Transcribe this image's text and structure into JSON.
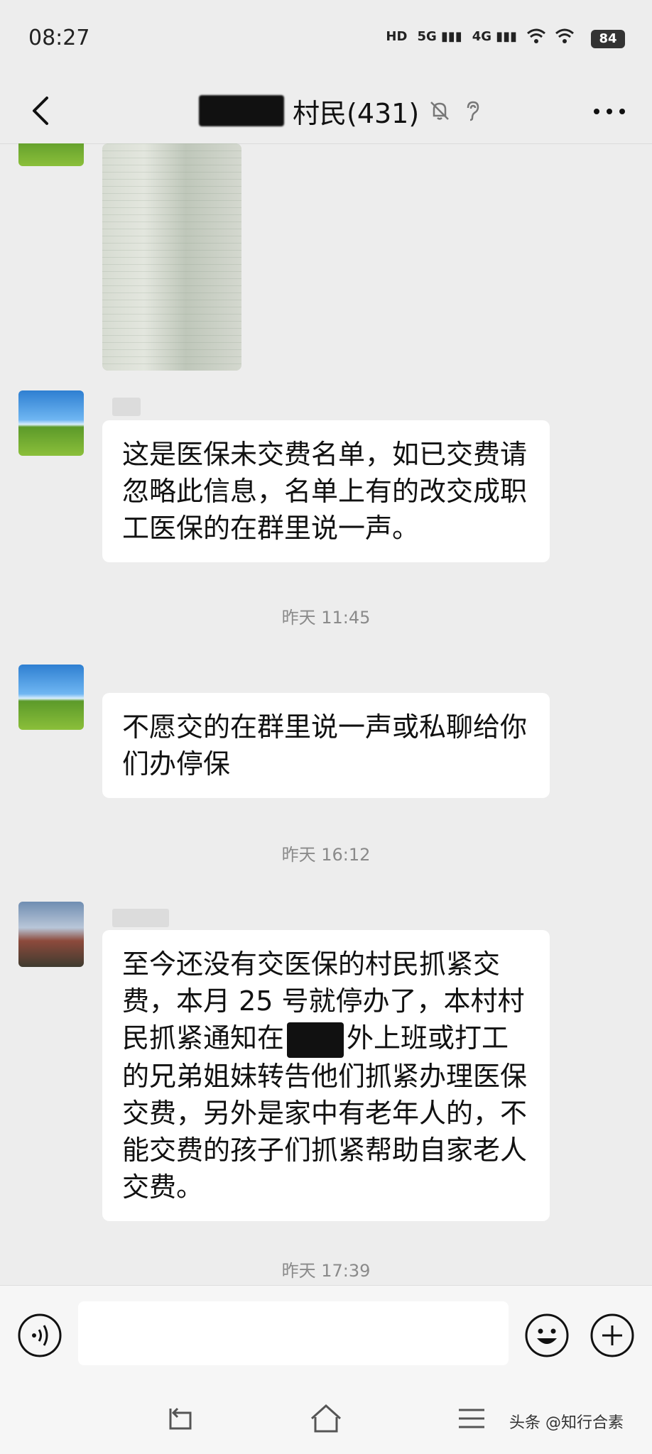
{
  "status_bar": {
    "time": "08:27",
    "indicators": [
      "HD",
      "5G",
      "4G",
      "wifi",
      "wifi"
    ],
    "battery": "84"
  },
  "header": {
    "title": "村民(431)",
    "icons": [
      "mute-icon",
      "ear-icon"
    ],
    "more_label": "..."
  },
  "messages": [
    {
      "type": "image",
      "desc_icon": "spreadsheet-image"
    },
    {
      "type": "text",
      "text": "这是医保未交费名单，如已交费请忽略此信息，名单上有的改交成职工医保的在群里说一声。"
    },
    {
      "type": "time",
      "text": "昨天 11:45"
    },
    {
      "type": "text",
      "text": "不愿交的在群里说一声或私聊给你们办停保"
    },
    {
      "type": "time",
      "text": "昨天 16:12"
    },
    {
      "type": "text",
      "text_part1": "至今还没有交医保的村民抓紧交费，本月 25 号就停办了，本村村民抓紧通知在",
      "text_part2": "外上班或打工的兄弟姐妹转告他们抓紧办理医保交费，另外是家中有老年人的，不能交费的孩子们抓紧帮助自家老人交费。"
    },
    {
      "type": "time",
      "text": "昨天 17:39"
    }
  ],
  "watermark": "头条 @知行合素",
  "colors": {
    "background": "#ededed",
    "bubble": "#ffffff",
    "timestamp": "#8a8a8a"
  }
}
